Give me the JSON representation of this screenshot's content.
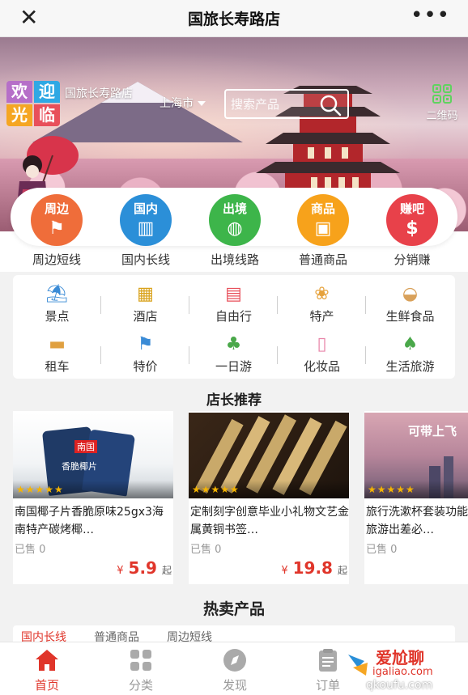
{
  "titlebar": {
    "close_glyph": "✕",
    "title": "国旅长寿路店",
    "more_glyph": "•••"
  },
  "banner": {
    "welcome_chars": [
      "欢",
      "迎",
      "光",
      "临"
    ],
    "welcome_colors": [
      "#b66fc8",
      "#2fa8e4",
      "#f5a623",
      "#e8505b"
    ],
    "store_name": "国旅长寿路店",
    "city": "上海市",
    "search_placeholder": "搜索产品",
    "qr_label": "二维码"
  },
  "categories": [
    {
      "label": "周边短线",
      "badge": "周边",
      "icon": "flag-icon",
      "glyph": "⚑",
      "color": "#ef6d3a"
    },
    {
      "label": "国内长线",
      "badge": "国内",
      "icon": "luggage-icon",
      "glyph": "▥",
      "color": "#2b8fd8"
    },
    {
      "label": "出境线路",
      "badge": "出境",
      "icon": "globe-icon",
      "glyph": "◍",
      "color": "#3db54a"
    },
    {
      "label": "普通商品",
      "badge": "商品",
      "icon": "gift-icon",
      "glyph": "▣",
      "color": "#f7a21b"
    },
    {
      "label": "分销赚",
      "badge": "赚吧",
      "icon": "money-bag-icon",
      "glyph": "$",
      "color": "#e8414a"
    }
  ],
  "grid": [
    {
      "label": "景点",
      "icon": "beach-icon",
      "glyph": "⛱",
      "color": "#3a8bd6"
    },
    {
      "label": "酒店",
      "icon": "hotel-icon",
      "glyph": "▦",
      "color": "#d9a21b"
    },
    {
      "label": "自由行",
      "icon": "suitcase-icon",
      "glyph": "▤",
      "color": "#e8505b"
    },
    {
      "label": "特产",
      "icon": "specialty-icon",
      "glyph": "❀",
      "color": "#e6a23c"
    },
    {
      "label": "生鲜食品",
      "icon": "bread-icon",
      "glyph": "◒",
      "color": "#d9a15a"
    },
    {
      "label": "租车",
      "icon": "car-icon",
      "glyph": "▬",
      "color": "#e0a040"
    },
    {
      "label": "特价",
      "icon": "flag-sale-icon",
      "glyph": "⚑",
      "color": "#3a8bd6"
    },
    {
      "label": "一日游",
      "icon": "forest-icon",
      "glyph": "♣",
      "color": "#4aa84a"
    },
    {
      "label": "化妆品",
      "icon": "cosmetics-icon",
      "glyph": "▯",
      "color": "#e884a8"
    },
    {
      "label": "生活旅游",
      "icon": "travel-life-icon",
      "glyph": "♠",
      "color": "#4aa84a"
    }
  ],
  "recommend_title": "店长推荐",
  "products": [
    {
      "name": "南国椰子片香脆原味25gx3海南特产碳烤椰…",
      "sold": "已售 0",
      "currency": "¥",
      "price": "5.9",
      "suffix": "起",
      "stars": "★★★★★",
      "img_text": "南国",
      "img_caption": "香脆椰片"
    },
    {
      "name": "定制刻字创意毕业小礼物文艺金属黄铜书签…",
      "sold": "已售 0",
      "currency": "¥",
      "price": "19.8",
      "suffix": "起",
      "stars": "★★★★★"
    },
    {
      "name": "旅行洗漱杯套装功能旅游出差必…",
      "sold": "已售 0",
      "currency": "¥",
      "price": "",
      "suffix": "",
      "stars": "★★★★★",
      "img_text": "可带上飞"
    }
  ],
  "hot_title": "热卖产品",
  "hot_tabs": [
    "国内长线",
    "普通商品",
    "周边短线"
  ],
  "nav": [
    {
      "label": "首页",
      "icon": "home-icon"
    },
    {
      "label": "分类",
      "icon": "category-icon"
    },
    {
      "label": "发现",
      "icon": "compass-icon"
    },
    {
      "label": "订单",
      "icon": "order-icon"
    }
  ],
  "watermark": {
    "line1": "爱尬聊",
    "line2": "igaliao.com",
    "line3": "qkoufu.com"
  }
}
